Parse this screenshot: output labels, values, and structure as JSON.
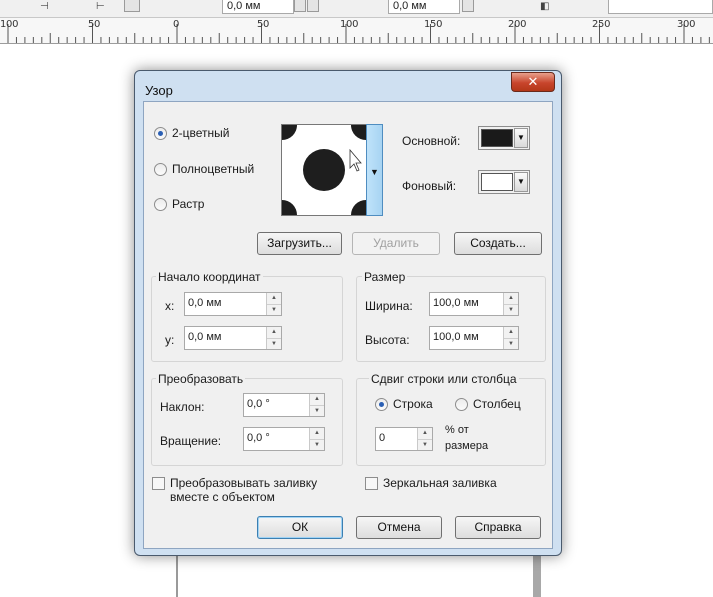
{
  "toolbar": {
    "pos_x_value": "0,0 мм",
    "pos_y_value": "0,0 мм"
  },
  "ruler": {
    "labels": [
      "100",
      "50",
      "0",
      "50",
      "100",
      "150",
      "200",
      "250",
      "300"
    ]
  },
  "dialog": {
    "title": "Узор",
    "close_label": "✕",
    "type": {
      "two_color": "2-цветный",
      "full_color": "Полноцветный",
      "bitmap": "Растр",
      "selected": "two_color"
    },
    "colors": {
      "primary_label": "Основной:",
      "primary_color": "#1a1a1a",
      "background_label": "Фоновый:",
      "background_color": "#ffffff"
    },
    "buttons": {
      "load": "Загрузить...",
      "delete": "Удалить",
      "create": "Создать..."
    },
    "origin": {
      "title": "Начало координат",
      "x_label": "x:",
      "x_value": "0,0 мм",
      "y_label": "y:",
      "y_value": "0,0 мм"
    },
    "size": {
      "title": "Размер",
      "width_label": "Ширина:",
      "width_value": "100,0 мм",
      "height_label": "Высота:",
      "height_value": "100,0 мм"
    },
    "transform": {
      "title": "Преобразовать",
      "skew_label": "Наклон:",
      "skew_value": "0,0 °",
      "rotate_label": "Вращение:",
      "rotate_value": "0,0 °"
    },
    "offset": {
      "title": "Сдвиг строки или столбца",
      "row": "Строка",
      "column": "Столбец",
      "selected": "row",
      "value": "0",
      "unit_line1": "% от",
      "unit_line2": "размера"
    },
    "options": {
      "transform_with_object_line1": "Преобразовывать заливку",
      "transform_with_object_line2": "вместе с объектом",
      "transform_with_object_checked": false,
      "mirror": "Зеркальная заливка",
      "mirror_checked": false
    },
    "footer": {
      "ok": "ОК",
      "cancel": "Отмена",
      "help": "Справка"
    }
  }
}
